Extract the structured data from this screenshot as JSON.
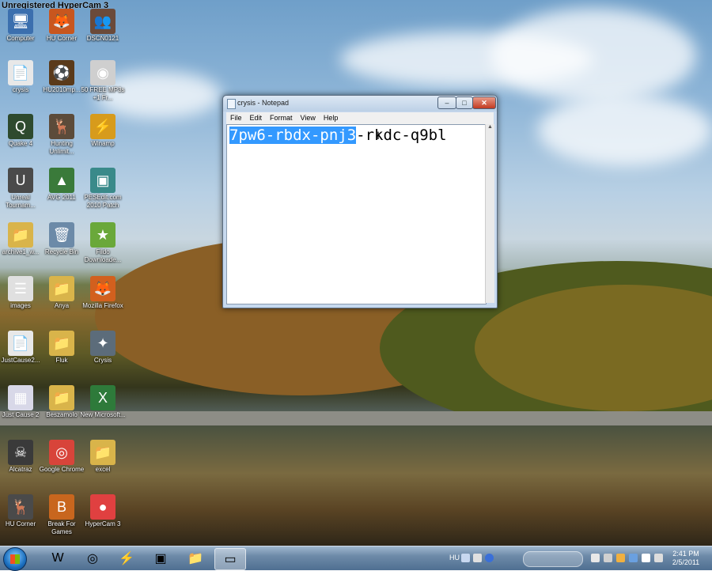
{
  "watermark": "Unregistered HyperCam 3",
  "desktop_icons": [
    {
      "label": "Computer",
      "glyph": "🖥",
      "color": "#3b6fae"
    },
    {
      "label": "HU Corner",
      "glyph": "🦊",
      "color": "#c8561e"
    },
    {
      "label": "DSCN0121",
      "glyph": "👥",
      "color": "#6b4a3a"
    },
    {
      "label": "crysis",
      "glyph": "📄",
      "color": "#e8e8e8"
    },
    {
      "label": "HU2010mp...",
      "glyph": "⚽",
      "color": "#5a3a1a"
    },
    {
      "label": "50 FREE MP3s +1 Fr...",
      "glyph": "◉",
      "color": "#cfcfcf"
    },
    {
      "label": "Quake 4",
      "glyph": "Q",
      "color": "#2e4a2e"
    },
    {
      "label": "Hunting Unlimit...",
      "glyph": "🦌",
      "color": "#5c4b3a"
    },
    {
      "label": "Winamp",
      "glyph": "⚡",
      "color": "#d79b1c"
    },
    {
      "label": "Unreal Tournam...",
      "glyph": "U",
      "color": "#4a4a4a"
    },
    {
      "label": "AVG 2011",
      "glyph": "▲",
      "color": "#3a7a3a"
    },
    {
      "label": "PESEdit.com 2010 Patch",
      "glyph": "▣",
      "color": "#3a8a8a"
    },
    {
      "label": "archive1_w...",
      "glyph": "📁",
      "color": "#d9b44a"
    },
    {
      "label": "Recycle Bin",
      "glyph": "🗑",
      "color": "#6c8aa8"
    },
    {
      "label": "Fildo Downloade...",
      "glyph": "★",
      "color": "#6aa83a"
    },
    {
      "label": "images",
      "glyph": "☰",
      "color": "#e0e0e0"
    },
    {
      "label": "Anya",
      "glyph": "📁",
      "color": "#d9b44a"
    },
    {
      "label": "Mozilla Firefox",
      "glyph": "🦊",
      "color": "#d2601e"
    },
    {
      "label": "JustCause2...",
      "glyph": "📄",
      "color": "#e8e8e8"
    },
    {
      "label": "Fluk",
      "glyph": "📁",
      "color": "#d9b44a"
    },
    {
      "label": "Crysis",
      "glyph": "✦",
      "color": "#5c6c7a"
    },
    {
      "label": "Just Cause 2",
      "glyph": "▦",
      "color": "#d8d8e8"
    },
    {
      "label": "Beszamolo",
      "glyph": "📁",
      "color": "#d9b44a"
    },
    {
      "label": "New Microsoft...",
      "glyph": "X",
      "color": "#2e7a3a"
    },
    {
      "label": "Alcatraz",
      "glyph": "☠",
      "color": "#3a3a3a"
    },
    {
      "label": "Google Chrome",
      "glyph": "◎",
      "color": "#d8443a"
    },
    {
      "label": "excel",
      "glyph": "📁",
      "color": "#d9b44a"
    },
    {
      "label": "HU Corner",
      "glyph": "🦌",
      "color": "#4a4a4a"
    },
    {
      "label": "Break For Games",
      "glyph": "B",
      "color": "#c8661e"
    },
    {
      "label": "HyperCam 3",
      "glyph": "●",
      "color": "#e04040"
    }
  ],
  "notepad": {
    "title": "crysis - Notepad",
    "menu": [
      "File",
      "Edit",
      "Format",
      "View",
      "Help"
    ],
    "selected_text": "7pw6-rbdx-pnj3",
    "rest_text": "-rkdc-q9bl",
    "buttons": {
      "minimize": "–",
      "maximize": "□",
      "close": "✕"
    }
  },
  "taskbar": {
    "items": [
      {
        "name": "word",
        "glyph": "W",
        "active": false
      },
      {
        "name": "chrome",
        "glyph": "◎",
        "active": false
      },
      {
        "name": "flashget",
        "glyph": "⚡",
        "active": false
      },
      {
        "name": "game",
        "glyph": "▣",
        "active": false
      },
      {
        "name": "explorer",
        "glyph": "📁",
        "active": false
      },
      {
        "name": "notepad",
        "glyph": "▭",
        "active": true
      }
    ],
    "language": "HU",
    "time": "2:41 PM",
    "date": "2/5/2011"
  }
}
